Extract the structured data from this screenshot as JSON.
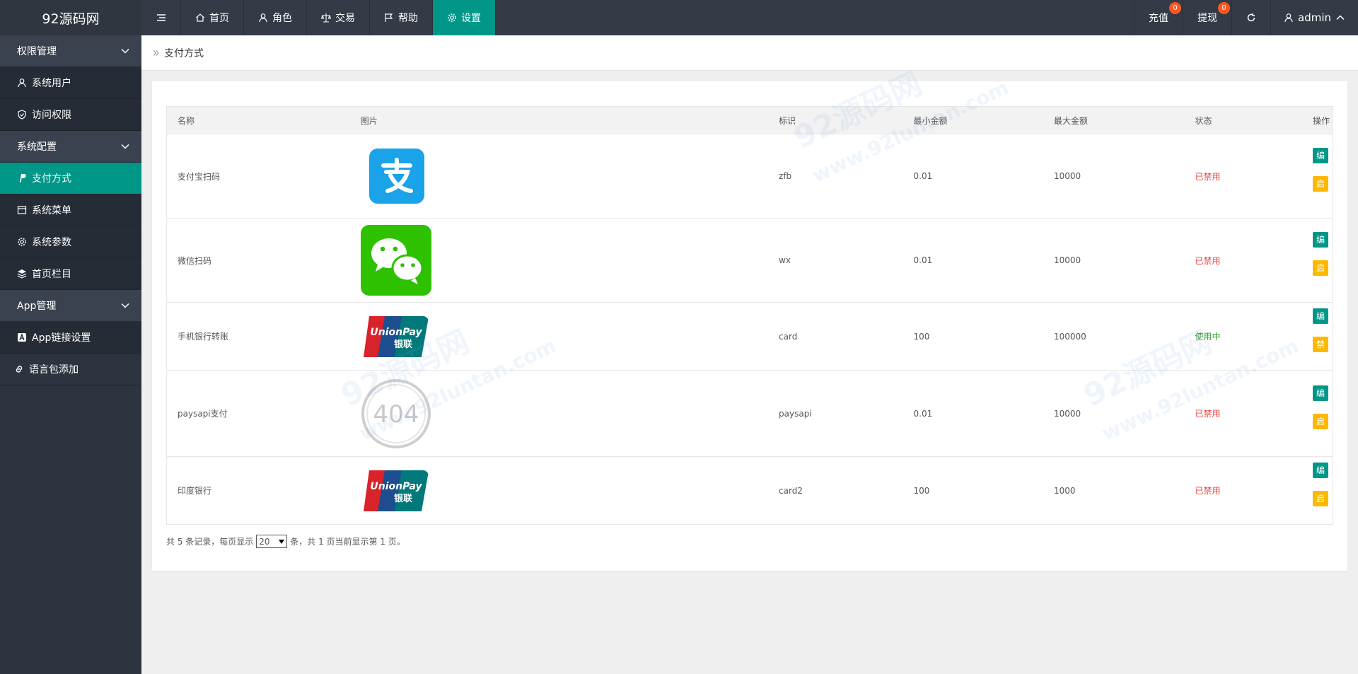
{
  "app": {
    "brand": "92源码网"
  },
  "topnav": {
    "items": [
      {
        "label": "首页",
        "icon": "home-icon"
      },
      {
        "label": "角色",
        "icon": "user-icon"
      },
      {
        "label": "交易",
        "icon": "scale-icon"
      },
      {
        "label": "帮助",
        "icon": "flag-icon"
      },
      {
        "label": "设置",
        "icon": "gear-icon"
      }
    ],
    "recharge": {
      "label": "充值",
      "count": "0"
    },
    "withdraw": {
      "label": "提现",
      "count": "0"
    },
    "user": "admin"
  },
  "sidebar": {
    "groups": [
      {
        "label": "权限管理"
      },
      {
        "label": "系统配置"
      },
      {
        "label": "App管理"
      }
    ],
    "items": [
      {
        "label": "系统用户"
      },
      {
        "label": "访问权限"
      },
      {
        "label": "支付方式"
      },
      {
        "label": "系统菜单"
      },
      {
        "label": "系统参数"
      },
      {
        "label": "首页栏目"
      },
      {
        "label": "App链接设置"
      },
      {
        "label": "语言包添加"
      }
    ]
  },
  "breadcrumb": {
    "current": "支付方式"
  },
  "table": {
    "columns": [
      "名称",
      "图片",
      "标识",
      "最小金额",
      "最大金额",
      "状态",
      "操作"
    ],
    "rows": [
      {
        "name": "支付宝扫码",
        "logo": "alipay-logo",
        "code": "zfb",
        "min": "0.01",
        "max": "10000",
        "status": "已禁用",
        "edit": "编 辑",
        "action": "启 用"
      },
      {
        "name": "微信扫码",
        "logo": "wechat-logo",
        "code": "wx",
        "min": "0.01",
        "max": "10000",
        "status": "已禁用",
        "edit": "编 辑",
        "action": "启 用"
      },
      {
        "name": "手机银行转账",
        "logo": "unionpay-logo",
        "code": "card",
        "min": "100",
        "max": "100000",
        "status": "使用中",
        "edit": "编 辑",
        "action": "禁 用"
      },
      {
        "name": "paysapi支付",
        "logo": "not-found-404",
        "code": "paysapi",
        "min": "0.01",
        "max": "10000",
        "status": "已禁用",
        "edit": "编 辑",
        "action": "启 用"
      },
      {
        "name": "印度银行",
        "logo": "unionpay-logo",
        "code": "card2",
        "min": "100",
        "max": "1000",
        "status": "已禁用",
        "edit": "编 辑",
        "action": "启 用"
      }
    ]
  },
  "pager": {
    "before": "共 5 条记录，每页显示",
    "per_page": "20",
    "after": "条，共 1 页当前显示第 1 页。"
  },
  "logo_text": {
    "unionpay": "UnionPay",
    "unionpay_cn": "银联",
    "not_found": "404"
  },
  "watermark": {
    "text": "92源码网",
    "url": "www.92luntan.com"
  },
  "colors": {
    "accent": "#009688",
    "warn": "#ffb800",
    "badge": "#ff5722",
    "topbar": "#343b46"
  }
}
